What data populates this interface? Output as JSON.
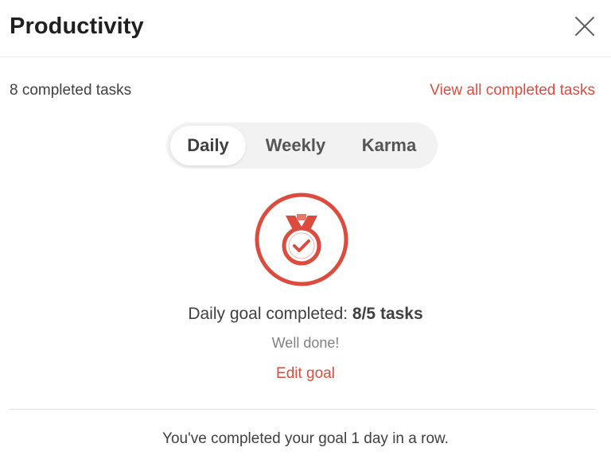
{
  "header": {
    "title": "Productivity",
    "close_icon": "close-icon"
  },
  "summary": {
    "completed_count": "8 completed tasks",
    "view_all_label": "View all completed tasks"
  },
  "tabs": [
    {
      "label": "Daily",
      "active": true
    },
    {
      "label": "Weekly",
      "active": false
    },
    {
      "label": "Karma",
      "active": false
    }
  ],
  "goal": {
    "medal_icon": "medal-check-icon",
    "text_prefix": "Daily goal completed: ",
    "text_value": "8/5 tasks",
    "message": "Well done!",
    "edit_label": "Edit goal",
    "progress_fraction": 1.0
  },
  "streak": {
    "text": "You've completed your goal 1 day in a row."
  },
  "colors": {
    "accent": "#dc4c3e",
    "text_primary": "#202020",
    "text_secondary": "#808080",
    "segment_bg": "#f2f2f2"
  }
}
